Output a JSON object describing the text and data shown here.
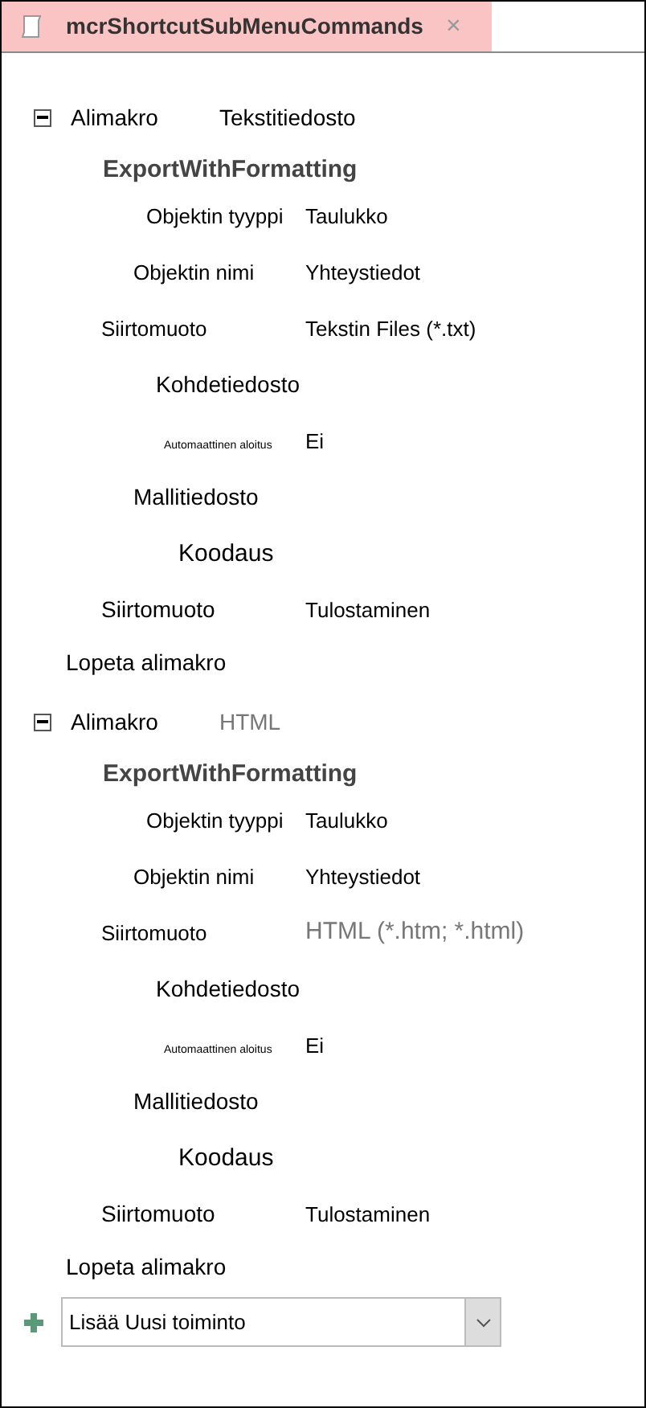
{
  "tab": {
    "title": "mcrShortcutSubMenuCommands",
    "close": "×",
    "selected": true
  },
  "submacros": [
    {
      "keyword": "Alimakro",
      "name": "Tekstitiedosto",
      "name_muted": false,
      "expanded": true,
      "action": "ExportWithFormatting",
      "arguments": [
        {
          "label": "Objektin tyyppi",
          "value": "Taulukko",
          "muted": false
        },
        {
          "label": "Objektin nimi",
          "value": "Yhteystiedot",
          "muted": false
        },
        {
          "label": "Siirtomuoto",
          "value": "Tekstin Files (*.txt)",
          "muted": false
        },
        {
          "label": "Kohdetiedosto"
        },
        {
          "label": "Automaattinen aloitus",
          "value": "Ei",
          "muted": false
        },
        {
          "label": "Mallitiedosto"
        },
        {
          "label": "Koodaus"
        },
        {
          "label": "Siirtomuoto",
          "value": "Tulostaminen",
          "muted": false
        }
      ],
      "end": "Lopeta alimakro"
    },
    {
      "keyword": "Alimakro",
      "name": "HTML",
      "name_muted": true,
      "expanded": true,
      "action": "ExportWithFormatting",
      "arguments": [
        {
          "label": "Objektin tyyppi",
          "value": "Taulukko",
          "muted": false
        },
        {
          "label": "Objektin nimi",
          "value": "Yhteystiedot",
          "muted": false
        },
        {
          "label": "Siirtomuoto",
          "value": "HTML (*.htm; *.html)",
          "muted": true
        },
        {
          "label": "Kohdetiedosto"
        },
        {
          "label": "Automaattinen aloitus",
          "value": "Ei",
          "muted": false
        },
        {
          "label": "Mallitiedosto"
        },
        {
          "label": "Koodaus"
        },
        {
          "label": "Siirtomuoto",
          "value": "Tulostaminen",
          "muted": false
        }
      ],
      "end": "Lopeta alimakro"
    }
  ],
  "add_action": {
    "value": "Lisää Uusi toiminto"
  }
}
